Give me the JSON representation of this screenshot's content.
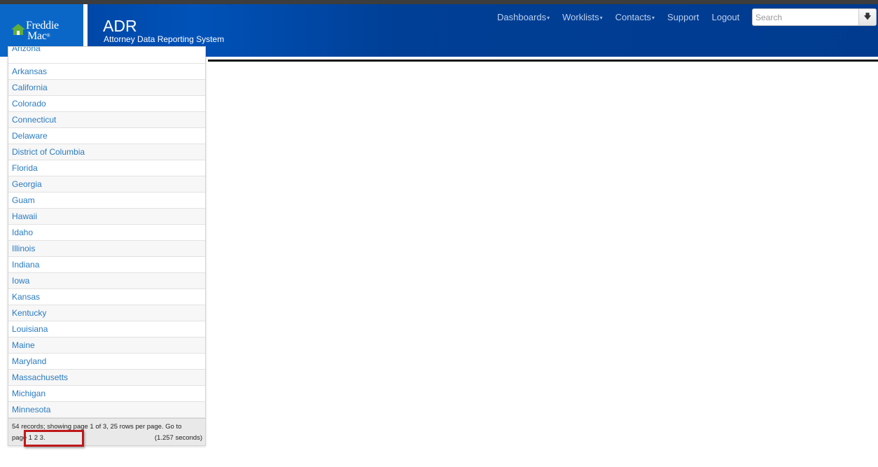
{
  "brand": {
    "logo_line1": "Freddie",
    "logo_line2": "Mac",
    "logo_mark": "®",
    "house_color": "#5fae3b",
    "app_title": "ADR",
    "app_subtitle": "Attorney Data Reporting System"
  },
  "nav": {
    "dashboards": "Dashboards",
    "worklists": "Worklists",
    "contacts": "Contacts",
    "support": "Support",
    "logout": "Logout",
    "caret": "▾"
  },
  "search": {
    "placeholder": "Search",
    "button_icon": "🡇",
    "button_icon_name": "download-arrow-icon"
  },
  "states": {
    "partial_top": "Arizona",
    "items": [
      "Arkansas",
      "California",
      "Colorado",
      "Connecticut",
      "Delaware",
      "District of Columbia",
      "Florida",
      "Georgia",
      "Guam",
      "Hawaii",
      "Idaho",
      "Illinois",
      "Indiana",
      "Iowa",
      "Kansas",
      "Kentucky",
      "Louisiana",
      "Maine",
      "Maryland",
      "Massachusetts",
      "Michigan",
      "Minnesota"
    ]
  },
  "pager": {
    "summary": "54 records; showing page 1 of 3, 25 rows per page. Go to",
    "goto_prefix": "page",
    "pages": [
      "1",
      "2",
      "3"
    ],
    "suffix": ".",
    "timing": "(1.257 seconds)"
  },
  "colors": {
    "header_blue": "#003f9a",
    "link_blue": "#2a7bc0",
    "highlight_red": "#c0181b"
  }
}
